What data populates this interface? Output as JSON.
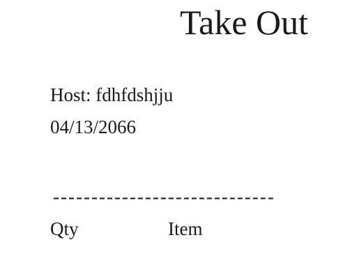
{
  "receipt": {
    "title": "Take Out",
    "host_text": "Host: fdhfdshjju",
    "date": "04/13/2066",
    "divider": "-----------------------------",
    "columns": {
      "qty": "Qty",
      "item": "Item"
    }
  }
}
